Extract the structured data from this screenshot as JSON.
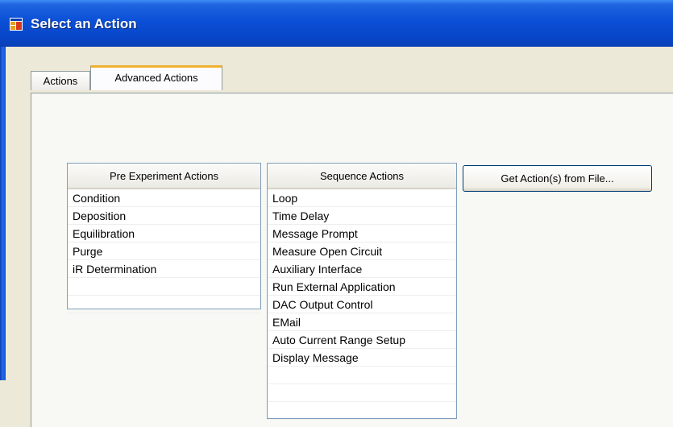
{
  "window": {
    "title": "Select an Action",
    "icon": "app-window-icon"
  },
  "tabs": [
    {
      "label": "Actions",
      "active": false
    },
    {
      "label": "Advanced Actions",
      "active": true
    }
  ],
  "pre_experiment": {
    "header": "Pre Experiment Actions",
    "items": [
      "Condition",
      "Deposition",
      "Equilibration",
      "Purge",
      "iR Determination",
      "",
      ""
    ]
  },
  "sequence": {
    "header": "Sequence Actions",
    "items": [
      "Loop",
      "Time Delay",
      "Message Prompt",
      "Measure Open Circuit",
      "Auxiliary Interface",
      "Run External Application",
      "DAC Output Control",
      "EMail",
      "Auto Current Range Setup",
      "Display Message",
      "",
      "",
      ""
    ]
  },
  "buttons": {
    "get_actions": "Get Action(s) from File..."
  },
  "colors": {
    "titlebar": "#0a4fd6",
    "tab_highlight": "#f0b030",
    "background": "#ece9d8"
  }
}
